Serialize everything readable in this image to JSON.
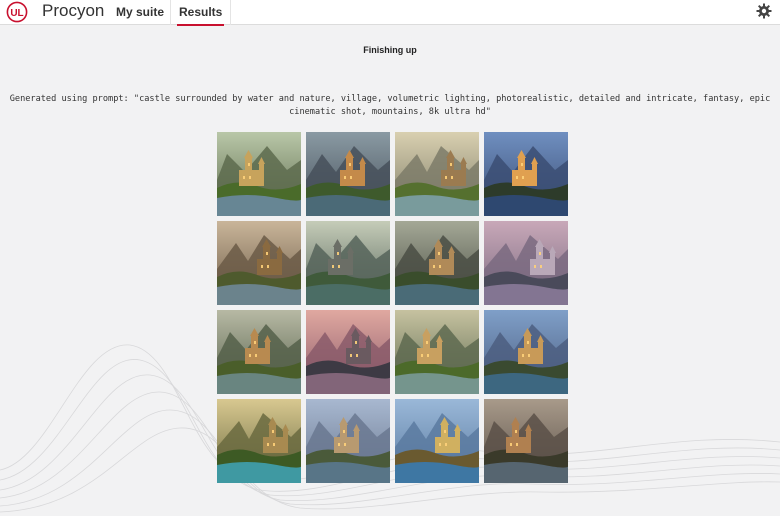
{
  "app": {
    "title": "Procyon"
  },
  "nav": {
    "items": [
      {
        "label": "My suite"
      },
      {
        "label": "Results"
      }
    ],
    "active": "Results"
  },
  "icons": {
    "logo": "ul-logo-icon",
    "settings": "gear-icon"
  },
  "colors": {
    "accent": "#c8102e",
    "topbar": "#ffffff",
    "background": "#f2f2f3"
  },
  "main": {
    "status": "Finishing up",
    "prompt": "Generated using prompt: \"castle surrounded by water and nature, village, volumetric lighting, photorealistic, detailed and intricate, fantasy, epic cinematic shot, mountains, 8k ultra hd\""
  },
  "images": [
    {
      "sky": "#b9c7a8",
      "mtn": "#5d6b4d",
      "ground": "#4a6b2a",
      "water": "#6a8aa0",
      "castle": "#c7a35c"
    },
    {
      "sky": "#8a9aa3",
      "mtn": "#46505a",
      "ground": "#3e5a2c",
      "water": "#4d6b80",
      "castle": "#c48a4a"
    },
    {
      "sky": "#d9d0b0",
      "mtn": "#7c7b68",
      "ground": "#55702f",
      "water": "#7da0a8",
      "castle": "#9b7b50"
    },
    {
      "sky": "#6f8fc0",
      "mtn": "#3b4d73",
      "ground": "#2d3b2a",
      "water": "#2f4a78",
      "castle": "#e0a050"
    },
    {
      "sky": "#c9b59a",
      "mtn": "#6b5a46",
      "ground": "#4e5a2d",
      "water": "#6f8797",
      "castle": "#8a6a40"
    },
    {
      "sky": "#c5ccb8",
      "mtn": "#56645a",
      "ground": "#3f5a3a",
      "water": "#4d6f6a",
      "castle": "#6b6e66"
    },
    {
      "sky": "#a4a896",
      "mtn": "#4a4e44",
      "ground": "#3a4d2c",
      "water": "#4d6f80",
      "castle": "#b08a58"
    },
    {
      "sky": "#c8a8b8",
      "mtn": "#7a6a80",
      "ground": "#4a4a5a",
      "water": "#8a7a98",
      "castle": "#b9a8b8"
    },
    {
      "sky": "#b7b9a4",
      "mtn": "#55604a",
      "ground": "#4a5e2a",
      "water": "#6d8a8a",
      "castle": "#b88a50"
    },
    {
      "sky": "#e0a8a0",
      "mtn": "#8a5a6a",
      "ground": "#3d3a44",
      "water": "#8a6a80",
      "castle": "#6a5a60"
    },
    {
      "sky": "#c6c2a0",
      "mtn": "#5e6a50",
      "ground": "#4c6a2a",
      "water": "#7a9a98",
      "castle": "#c8a060"
    },
    {
      "sky": "#7f9fc8",
      "mtn": "#4c5e80",
      "ground": "#3a4a30",
      "water": "#3e6a8a",
      "castle": "#c89a58"
    },
    {
      "sky": "#d8c890",
      "mtn": "#6a6a40",
      "ground": "#3d5a24",
      "water": "#3fa0b0",
      "castle": "#a88a50"
    },
    {
      "sky": "#a8b8d0",
      "mtn": "#6a7890",
      "ground": "#4a5a3a",
      "water": "#5a7890",
      "castle": "#b89a70"
    },
    {
      "sky": "#9ab8d8",
      "mtn": "#5a7aa0",
      "ground": "#6a5a30",
      "water": "#3a7ab0",
      "castle": "#d0b060"
    },
    {
      "sky": "#a89a8a",
      "mtn": "#5a5048",
      "ground": "#3a3a2a",
      "water": "#5a6a78",
      "castle": "#b08050"
    }
  ]
}
